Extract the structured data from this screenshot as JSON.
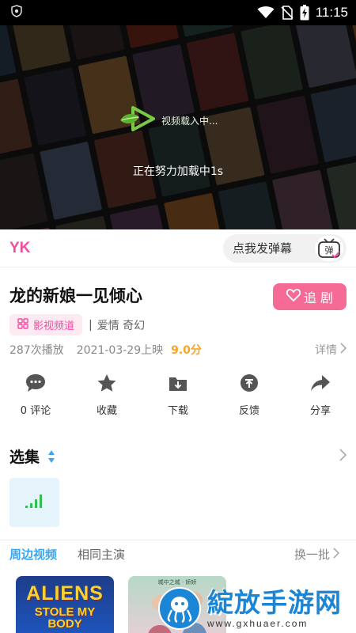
{
  "status_bar": {
    "time": "11:15"
  },
  "player": {
    "loader_text": "视频载入中...",
    "loading_status": "正在努力加载中1s"
  },
  "danmaku": {
    "logo": "YK",
    "input_placeholder": "点我发弹幕",
    "toggle_label": "弹"
  },
  "show": {
    "title": "龙的新娘一见倾心",
    "follow_label": "追 剧",
    "channel_tag": "影视频道",
    "genres": "爱情 奇幻",
    "plays": "287次播放",
    "release": "2021-03-29上映",
    "score": "9.0分",
    "detail_label": "详情"
  },
  "actions": [
    {
      "label": "0 评论",
      "icon": "comment-icon"
    },
    {
      "label": "收藏",
      "icon": "star-icon"
    },
    {
      "label": "下载",
      "icon": "download-icon"
    },
    {
      "label": "反馈",
      "icon": "feedback-icon"
    },
    {
      "label": "分享",
      "icon": "share-icon"
    }
  ],
  "episodes": {
    "title": "选集"
  },
  "related": {
    "tabs": [
      "周边视频",
      "相同主演"
    ],
    "refresh_label": "换一批",
    "thumb1": {
      "title": "ALIENS",
      "subtitle_line1": "STOLE MY",
      "subtitle_line2": "BODY"
    },
    "thumb2": {
      "label": "城中之城 · 娇娇"
    }
  },
  "watermark": {
    "brand": "綻放手游网",
    "url": "www.gxhuaer.com"
  },
  "colors": {
    "accent_pink": "#f24ca1",
    "follow_pink": "#f66b95",
    "tab_blue": "#39a6ef",
    "score_orange": "#f5a623"
  }
}
